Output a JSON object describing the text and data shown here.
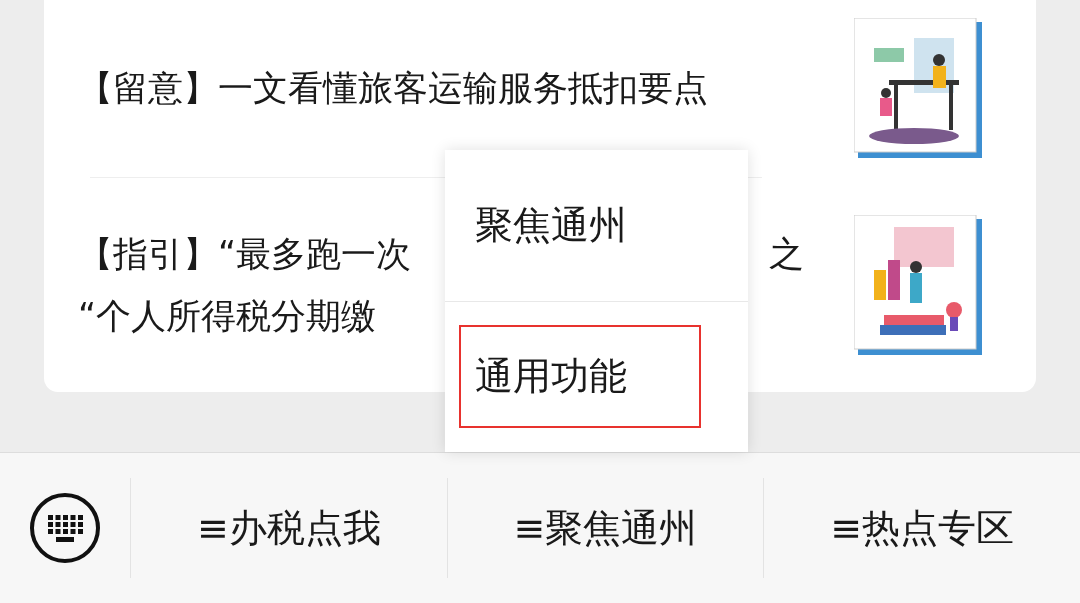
{
  "articles": [
    {
      "title_lines": [
        {
          "left": "【留意】一文看懂旅客运输服务抵扣要点"
        }
      ],
      "thumbnail": {
        "kind": "picture"
      }
    },
    {
      "title_lines": [
        {
          "left": "【指引】“最多跑一次",
          "right": "之"
        },
        {
          "left": "“个人所得税分期缴"
        }
      ],
      "thumbnail": {
        "kind": "picture"
      }
    }
  ],
  "popup_menu": {
    "items": [
      {
        "label": "聚焦通州",
        "highlighted": false
      },
      {
        "label": "通用功能",
        "highlighted": true
      }
    ]
  },
  "bottom_menu": {
    "items": [
      {
        "icon": "≡",
        "label": "办税点我"
      },
      {
        "icon": "≡",
        "label": "聚焦通州"
      },
      {
        "icon": "≡",
        "label": "热点专区"
      }
    ]
  }
}
